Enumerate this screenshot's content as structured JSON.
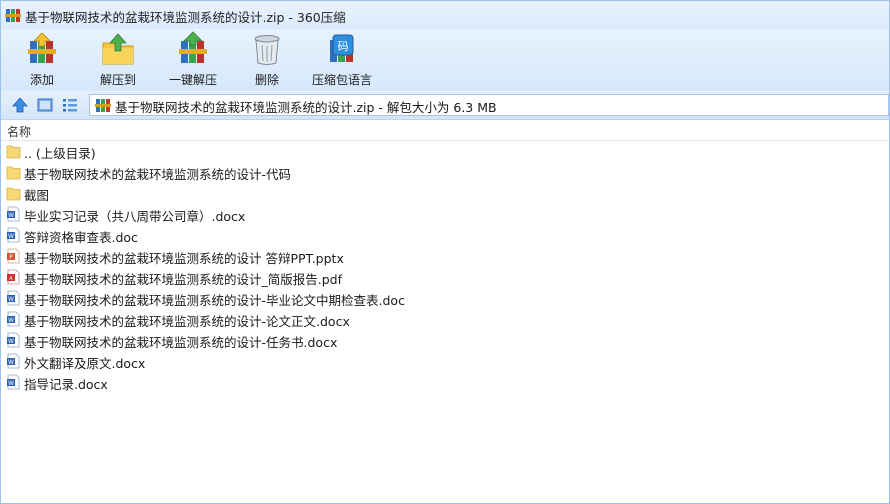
{
  "window": {
    "title": "基于物联网技术的盆栽环境监测系统的设计.zip - 360压缩",
    "accent_color": "#dbeafb"
  },
  "toolbar": {
    "buttons": [
      {
        "label": "添加",
        "icon": "add-archive-icon"
      },
      {
        "label": "解压到",
        "icon": "extract-to-icon"
      },
      {
        "label": "一键解压",
        "icon": "one-click-extract-icon"
      },
      {
        "label": "删除",
        "icon": "delete-trash-icon"
      },
      {
        "label": "压缩包语言",
        "icon": "archive-language-icon"
      }
    ]
  },
  "addressbar": {
    "path": "基于物联网技术的盆栽环境监测系统的设计.zip - 解包大小为 6.3 MB"
  },
  "filelist": {
    "column_name": "名称",
    "items": [
      {
        "name": ".. (上级目录)",
        "type": "folder"
      },
      {
        "name": "基于物联网技术的盆栽环境监测系统的设计-代码",
        "type": "folder"
      },
      {
        "name": "截图",
        "type": "folder"
      },
      {
        "name": "毕业实习记录（共八周带公司章）.docx",
        "type": "word"
      },
      {
        "name": "答辩资格审查表.doc",
        "type": "word"
      },
      {
        "name": "基于物联网技术的盆栽环境监测系统的设计 答辩PPT.pptx",
        "type": "ppt"
      },
      {
        "name": "基于物联网技术的盆栽环境监测系统的设计_简版报告.pdf",
        "type": "pdf"
      },
      {
        "name": "基于物联网技术的盆栽环境监测系统的设计-毕业论文中期检查表.doc",
        "type": "word"
      },
      {
        "name": "基于物联网技术的盆栽环境监测系统的设计-论文正文.docx",
        "type": "word"
      },
      {
        "name": "基于物联网技术的盆栽环境监测系统的设计-任务书.docx",
        "type": "word"
      },
      {
        "name": "外文翻译及原文.docx",
        "type": "word"
      },
      {
        "name": "指导记录.docx",
        "type": "word"
      }
    ]
  }
}
